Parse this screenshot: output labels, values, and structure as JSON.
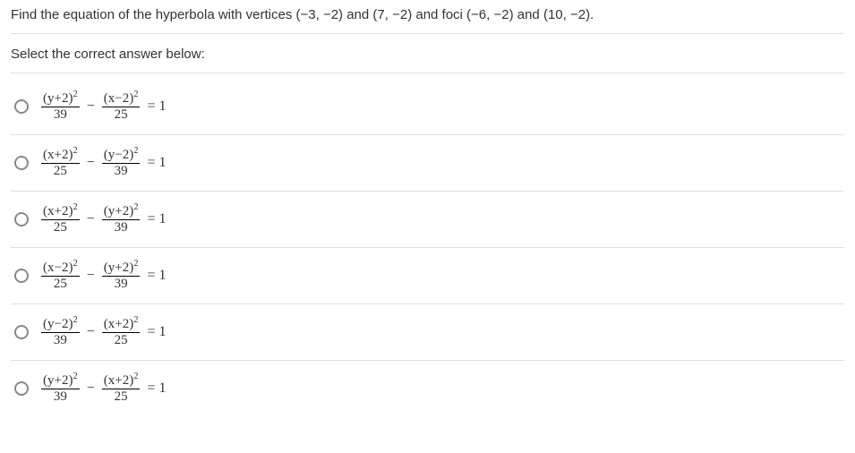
{
  "question": "Find the equation of the hyperbola with vertices (−3, −2) and (7, −2) and foci (−6, −2) and (10, −2).",
  "prompt": "Select the correct answer below:",
  "options": [
    {
      "t1_num": "(y+2)",
      "t1_den": "39",
      "t2_num": "(x−2)",
      "t2_den": "25"
    },
    {
      "t1_num": "(x+2)",
      "t1_den": "25",
      "t2_num": "(y−2)",
      "t2_den": "39"
    },
    {
      "t1_num": "(x+2)",
      "t1_den": "25",
      "t2_num": "(y+2)",
      "t2_den": "39"
    },
    {
      "t1_num": "(x−2)",
      "t1_den": "25",
      "t2_num": "(y+2)",
      "t2_den": "39"
    },
    {
      "t1_num": "(y−2)",
      "t1_den": "39",
      "t2_num": "(x+2)",
      "t2_den": "25"
    },
    {
      "t1_num": "(y+2)",
      "t1_den": "39",
      "t2_num": "(x+2)",
      "t2_den": "25"
    }
  ],
  "minus": "−",
  "equals": "= 1",
  "sup": "2"
}
